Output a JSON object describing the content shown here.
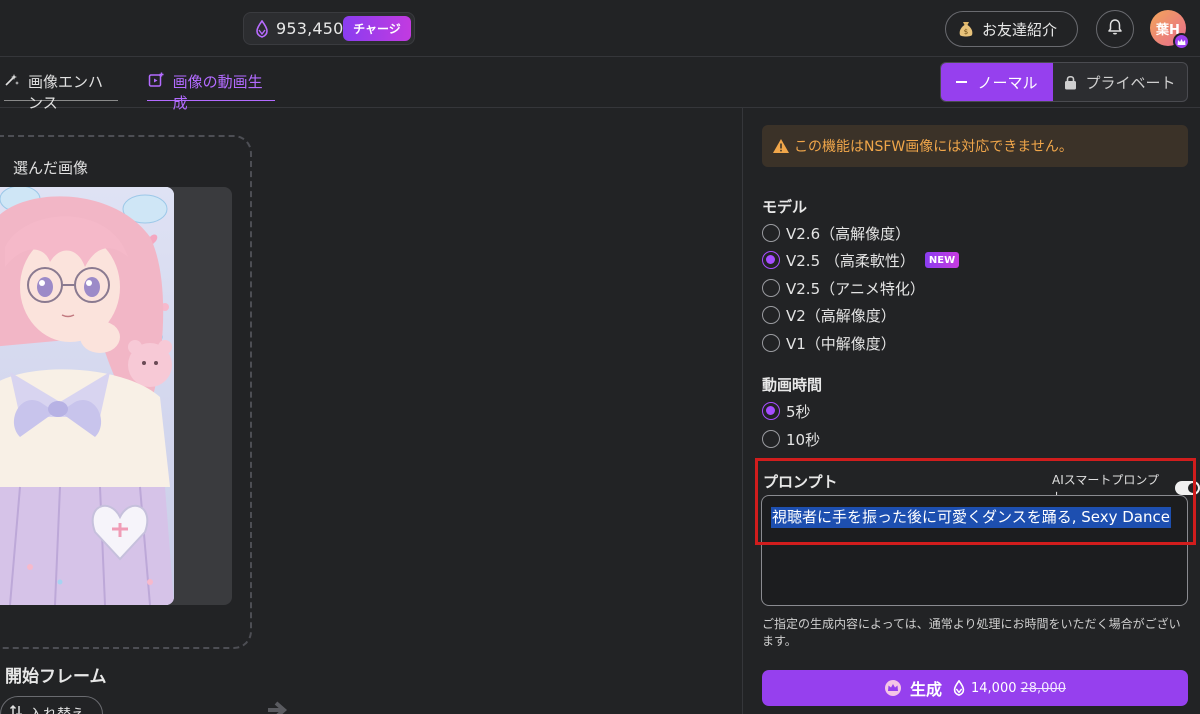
{
  "header": {
    "credits": "953,450",
    "charge_label": "チャージ",
    "invite_label": "お友達紹介",
    "avatar_text": "葉H"
  },
  "tabs": [
    {
      "label": "画像エンハンス",
      "icon": "enhance-icon",
      "active": false
    },
    {
      "label": "画像の動画生成",
      "icon": "video-generate-icon",
      "active": true
    }
  ],
  "mode": {
    "normal_label": "ノーマル",
    "private_label": "プライベート"
  },
  "left": {
    "selected_image_label": "選んだ画像",
    "start_frame_label": "開始フレーム",
    "swap_label": "入れ替え"
  },
  "panel": {
    "warning": "この機能はNSFW画像には対応できません。",
    "model_title": "モデル",
    "models": [
      {
        "label": "V2.6（高解像度）",
        "checked": false,
        "badge": ""
      },
      {
        "label": "V2.5 （高柔軟性）",
        "checked": true,
        "badge": "NEW"
      },
      {
        "label": "V2.5（アニメ特化）",
        "checked": false,
        "badge": ""
      },
      {
        "label": "V2（高解像度）",
        "checked": false,
        "badge": ""
      },
      {
        "label": "V1（中解像度）",
        "checked": false,
        "badge": ""
      }
    ],
    "duration_title": "動画時間",
    "durations": [
      {
        "label": "5秒",
        "checked": true
      },
      {
        "label": "10秒",
        "checked": false
      }
    ],
    "prompt_title": "プロンプト",
    "ai_smart_label": "AIスマートプロンプト",
    "prompt_value": "視聴者に手を振った後に可愛くダンスを踊る, Sexy Dance",
    "note": "ご指定の生成内容によっては、通常より処理にお時間をいただく場合がございます。",
    "generate_label": "生成",
    "generate_price": "14,000",
    "generate_old_price": "28,000"
  },
  "colors": {
    "accent": "#9640ee",
    "active_tab": "#b36bff",
    "warning_text": "#f0a64a",
    "highlight_border": "#d11d1d"
  }
}
